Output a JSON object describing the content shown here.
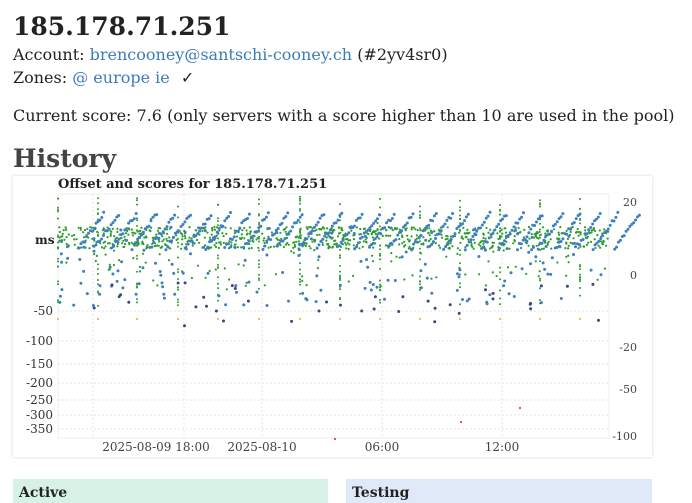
{
  "server": {
    "title": "185.178.71.251",
    "account_label": "Account:",
    "account_email": "brencooney@santschi-cooney.ch",
    "account_id": "(#2yv4sr0)",
    "zones_label": "Zones:",
    "zone_links": "@ europe ie",
    "zones_check": "✓",
    "score_text": "Current score: 7.6 (only servers with a score higher than 10 are used in the pool)"
  },
  "history": {
    "heading": "History"
  },
  "chart_data": {
    "type": "scatter",
    "title": "Offset and scores for 185.178.71.251",
    "ylabel_left": "ms",
    "x_ticks": [
      "2025-08-09 18:00",
      "2025-08-10",
      "06:00",
      "12:00"
    ],
    "y_left_ticks": [
      "-50",
      "-100",
      "-150",
      "-200",
      "-250",
      "-300",
      "-350"
    ],
    "y_right_ticks": [
      "20",
      "0",
      "-20",
      "-50",
      "-100"
    ],
    "series": [
      {
        "values": "offset points (green), mostly near 0 ms with outliers toward -50 ms"
      },
      {
        "values": "score points (blue), sawtooth pattern between about 0 and 20, with dips toward -50"
      }
    ],
    "colors": {
      "offset": "#2a9d2a",
      "score": "#3f7fbf",
      "outlier_orange": "#f0a030",
      "outlier_red": "#d62020"
    }
  },
  "panels": {
    "active": "Active",
    "testing": "Testing"
  }
}
